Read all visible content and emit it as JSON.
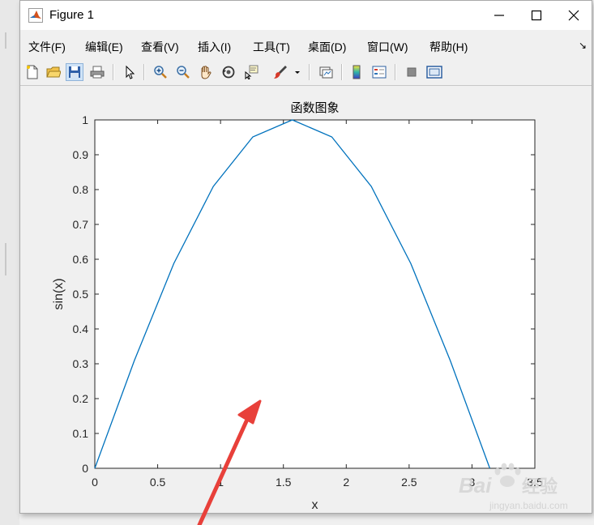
{
  "window": {
    "title": "Figure 1"
  },
  "menu": {
    "items": [
      "文件(F)",
      "编辑(E)",
      "查看(V)",
      "插入(I)",
      "工具(T)",
      "桌面(D)",
      "窗口(W)",
      "帮助(H)"
    ],
    "more": "↘"
  },
  "toolbar": {
    "icons": [
      "new-figure-icon",
      "open-file-icon",
      "save-icon",
      "print-icon",
      "edit-plot-arrow-icon",
      "zoom-in-icon",
      "zoom-out-icon",
      "pan-hand-icon",
      "rotate-3d-icon",
      "data-cursor-icon",
      "brush-icon",
      "brush-dropdown-icon",
      "link-plot-icon",
      "colorbar-icon",
      "legend-icon",
      "hide-plot-tools-icon",
      "show-plot-tools-icon"
    ]
  },
  "chart_data": {
    "type": "line",
    "title": "函数图象",
    "xlabel": "x",
    "ylabel": "sin(x)",
    "xlim": [
      0,
      3.5
    ],
    "ylim": [
      0,
      1
    ],
    "xticks": [
      "0",
      "0.5",
      "1",
      "1.5",
      "2",
      "2.5",
      "3",
      "3.5"
    ],
    "yticks": [
      "0",
      "0.1",
      "0.2",
      "0.3",
      "0.4",
      "0.5",
      "0.6",
      "0.7",
      "0.8",
      "0.9",
      "1"
    ],
    "grid": false,
    "series": [
      {
        "color": "#0072bd",
        "x": [
          0,
          0.3142,
          0.6283,
          0.9425,
          1.2566,
          1.5708,
          1.885,
          2.1991,
          2.5133,
          2.8274,
          3.1416
        ],
        "y": [
          0,
          0.309,
          0.5878,
          0.809,
          0.9511,
          1.0,
          0.9511,
          0.809,
          0.5878,
          0.309,
          0
        ]
      }
    ]
  },
  "annotation": {
    "arrow_color": "#e8403a"
  },
  "watermark": {
    "logo": "Baidu 经验",
    "url": "jingyan.baidu.com"
  }
}
